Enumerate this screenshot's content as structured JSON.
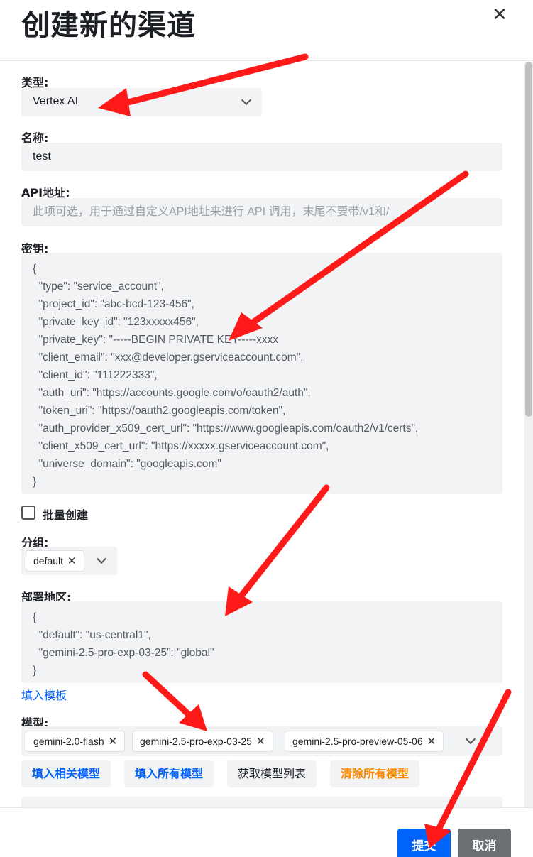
{
  "modal": {
    "title": "创建新的渠道",
    "close_icon": "close-icon"
  },
  "form": {
    "type": {
      "label": "类型:",
      "value": "Vertex AI"
    },
    "name": {
      "label": "名称:",
      "value": "test"
    },
    "api_url": {
      "label": "API地址:",
      "placeholder": "此项可选，用于通过自定义API地址来进行 API 调用，末尾不要带/v1和/"
    },
    "key": {
      "label": "密钥:",
      "value": "{\n  \"type\": \"service_account\",\n  \"project_id\": \"abc-bcd-123-456\",\n  \"private_key_id\": \"123xxxxx456\",\n  \"private_key\": \"-----BEGIN PRIVATE KEY-----xxxx\n  \"client_email\": \"xxx@developer.gserviceaccount.com\",\n  \"client_id\": \"111222333\",\n  \"auth_uri\": \"https://accounts.google.com/o/oauth2/auth\",\n  \"token_uri\": \"https://oauth2.googleapis.com/token\",\n  \"auth_provider_x509_cert_url\": \"https://www.googleapis.com/oauth2/v1/certs\",\n  \"client_x509_cert_url\": \"https://xxxxx.gserviceaccount.com\",\n  \"universe_domain\": \"googleapis.com\"\n}"
    },
    "batch_create": {
      "label": "批量创建",
      "checked": false
    },
    "group": {
      "label": "分组:",
      "tags": [
        "default"
      ]
    },
    "region": {
      "label": "部署地区:",
      "value": "{\n  \"default\": \"us-central1\",\n  \"gemini-2.5-pro-exp-03-25\": \"global\"\n}",
      "fill_template_link": "填入模板"
    },
    "models": {
      "label": "模型:",
      "tags": [
        "gemini-2.0-flash",
        "gemini-2.5-pro-exp-03-25",
        "gemini-2.5-pro-preview-05-06"
      ],
      "buttons": {
        "fill_related": "填入相关模型",
        "fill_all": "填入所有模型",
        "fetch_list": "获取模型列表",
        "clear_all": "清除所有模型"
      }
    }
  },
  "footer": {
    "submit": "提交",
    "cancel": "取消"
  },
  "colors": {
    "primary": "#0064fa",
    "warning": "#fc8800",
    "field_bg": "#f2f3f5",
    "annotation_arrow": "#ff1a1a"
  }
}
